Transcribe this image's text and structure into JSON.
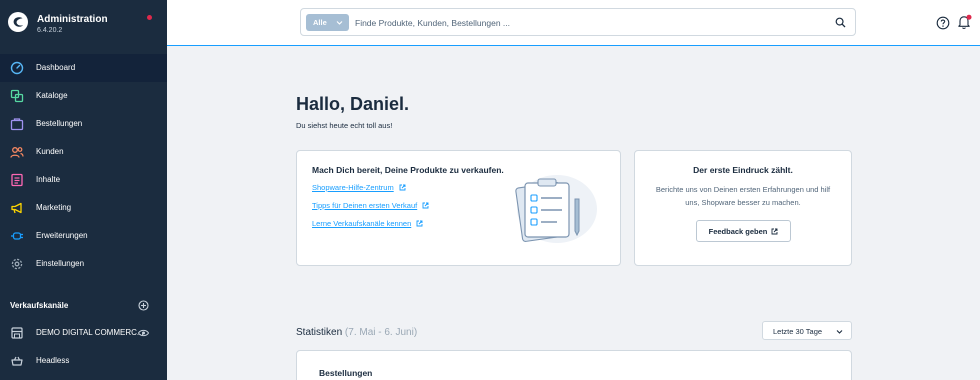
{
  "brand": {
    "title": "Administration",
    "version": "6.4.20.2"
  },
  "nav": [
    {
      "label": "Dashboard",
      "icon": "dashboard-icon",
      "color": "#57b6f5",
      "active": true
    },
    {
      "label": "Kataloge",
      "icon": "catalog-icon",
      "color": "#57d9a3"
    },
    {
      "label": "Bestellungen",
      "icon": "orders-icon",
      "color": "#a092f0"
    },
    {
      "label": "Kunden",
      "icon": "customers-icon",
      "color": "#f88962"
    },
    {
      "label": "Inhalte",
      "icon": "content-icon",
      "color": "#ff68b4"
    },
    {
      "label": "Marketing",
      "icon": "marketing-icon",
      "color": "#ffd700"
    },
    {
      "label": "Erweiterungen",
      "icon": "extensions-icon",
      "color": "#189eff"
    },
    {
      "label": "Einstellungen",
      "icon": "settings-icon",
      "color": "#9aa8b5"
    }
  ],
  "sales_channels": {
    "title": "Verkaufskanäle",
    "items": [
      {
        "label": "DEMO DIGITAL COMMERC...",
        "icon": "storefront-icon"
      },
      {
        "label": "Headless",
        "icon": "headless-icon"
      }
    ]
  },
  "search": {
    "type_label": "Alle",
    "placeholder": "Finde Produkte, Kunden, Bestellungen ..."
  },
  "welcome": {
    "greeting": "Hallo, Daniel.",
    "subtitle": "Du siehst heute echt toll aus!"
  },
  "getting_started": {
    "title": "Mach Dich bereit, Deine Produkte zu verkaufen.",
    "links": [
      "Shopware-Hilfe-Zentrum",
      "Tipps für Deinen ersten Verkauf",
      "Lerne Verkaufskanäle kennen"
    ]
  },
  "feedback": {
    "title": "Der erste Eindruck zählt.",
    "text": "Berichte uns von Deinen ersten Erfahrungen und hilf uns, Shopware besser zu machen.",
    "button": "Feedback geben"
  },
  "statistics": {
    "title": "Statistiken",
    "range": "(7. Mai - 6. Juni)",
    "select": "Letzte 30 Tage",
    "card_title": "Bestellungen"
  },
  "colors": {
    "sidebar": "#1b2c3f",
    "accent": "#189eff",
    "badge": "#de294c"
  }
}
